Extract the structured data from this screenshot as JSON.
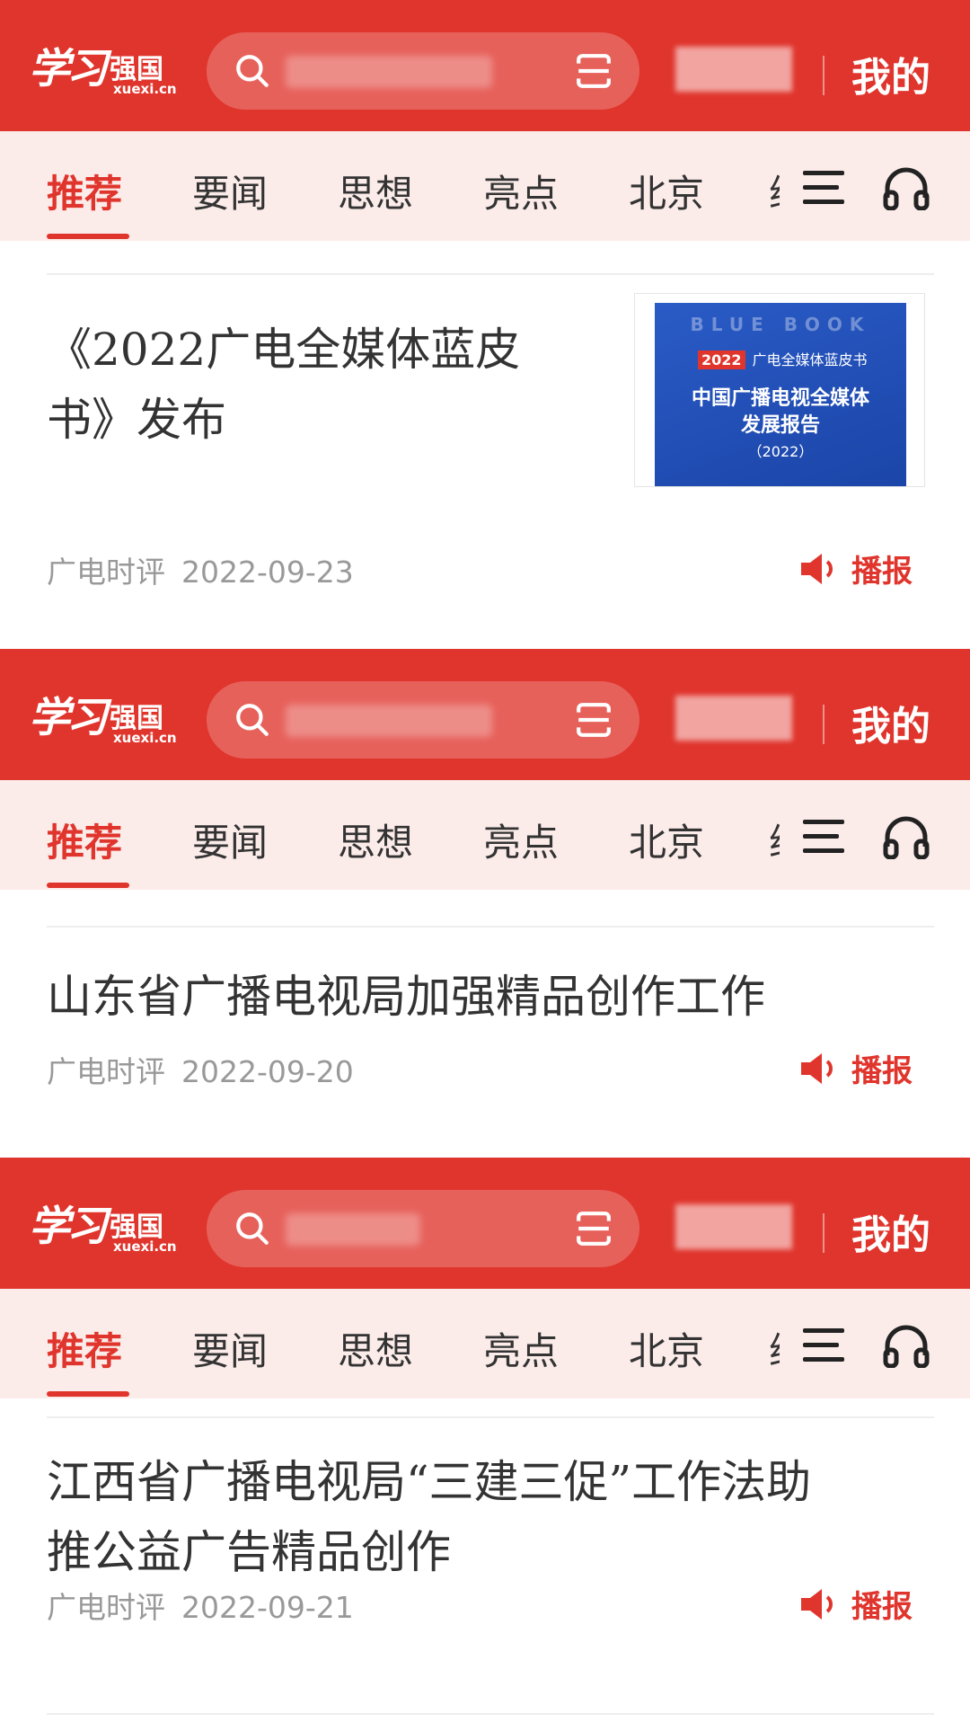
{
  "header": {
    "logo_text": "学习强国",
    "logo_cn": "强国",
    "logo_en": "xuexi.cn",
    "mine_label": "我的"
  },
  "tabs": [
    "推荐",
    "要闻",
    "思想",
    "亮点",
    "北京"
  ],
  "articles": [
    {
      "title_line1": "《2022广电全媒体蓝皮",
      "title_line2": "书》发布",
      "source": "广电时评",
      "date": "2022-09-23",
      "play_label": "播报",
      "thumbnail": {
        "cover_top": "BLUE BOOK",
        "badge": "2022",
        "line1": "广电全媒体蓝皮书",
        "line2": "中国广播电视全媒体",
        "line3": "发展报告",
        "line4": "（2022）"
      }
    },
    {
      "title_line1": "山东省广播电视局加强精品创作工作",
      "source": "广电时评",
      "date": "2022-09-20",
      "play_label": "播报"
    },
    {
      "title_line1": "江西省广播电视局“三建三促”工作法助",
      "title_line2": "推公益广告精品创作",
      "source": "广电时评",
      "date": "2022-09-21",
      "play_label": "播报"
    }
  ],
  "colors": {
    "brand_red": "#e0352d",
    "tab_bg": "#fbecea",
    "meta_grey": "#999999"
  }
}
